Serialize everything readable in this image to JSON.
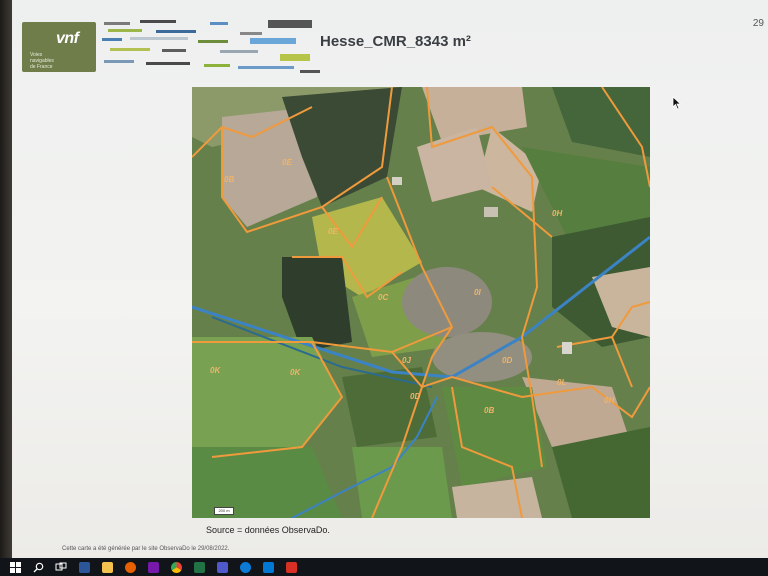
{
  "document": {
    "title": "Hesse_CMR_8343 m²",
    "page_number": "29",
    "source": "Source = données ObservaDo.",
    "footer": "Cette carte a été générée par le site ObservaDo le 29/08/2022."
  },
  "logo": {
    "brand": "vnf",
    "subtitle": "Voies\nnavigables\nde France",
    "color": "#6f7d4a"
  },
  "map": {
    "scale_label": "200 m",
    "parcel_labels": [
      "0E",
      "0B",
      "0E",
      "0C",
      "0H",
      "0I",
      "0J",
      "0D",
      "0K",
      "0K",
      "0D",
      "0L",
      "0H",
      "0B"
    ],
    "parcel_line_color": "#ef9a3c",
    "canal_color": "#3b83c5"
  },
  "taskbar": {
    "icons": [
      {
        "name": "windows-start-icon",
        "color": "#ffffff"
      },
      {
        "name": "search-icon",
        "color": "#ffffff"
      },
      {
        "name": "task-view-icon",
        "color": "#ffffff"
      },
      {
        "name": "word-icon",
        "color": "#2b579a"
      },
      {
        "name": "file-explorer-icon",
        "color": "#f2c14e"
      },
      {
        "name": "firefox-icon",
        "color": "#e66000"
      },
      {
        "name": "onenote-icon",
        "color": "#7719aa"
      },
      {
        "name": "chrome-icon",
        "color": "#34a853"
      },
      {
        "name": "excel-icon",
        "color": "#217346"
      },
      {
        "name": "teams-icon",
        "color": "#5059c9"
      },
      {
        "name": "edge-icon",
        "color": "#0c7bd6"
      },
      {
        "name": "outlook-icon",
        "color": "#0078d4"
      },
      {
        "name": "acrobat-icon",
        "color": "#d93025"
      }
    ]
  }
}
